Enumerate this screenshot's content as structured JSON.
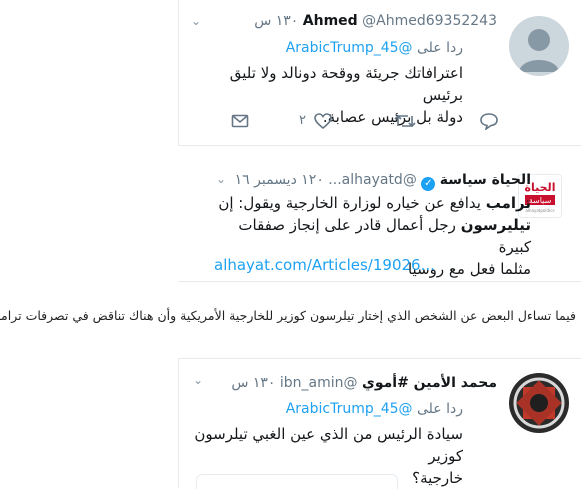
{
  "tweet1": {
    "name": "Ahmed",
    "handle": "@Ahmed69352243",
    "time": "١٣٠ س",
    "reply_prefix": "ردا على",
    "reply_mention": "@ArabicTrump_45",
    "body_line1": "اعترافاتك جريئة ووقحة دونالد ولا تليق برئيس",
    "body_line2": "دولة بل برئيس عصابة.",
    "like_count": "٢",
    "icons": [
      "chevron-down-icon",
      "reply-icon",
      "retweet-icon",
      "like-icon",
      "message-icon"
    ]
  },
  "tweet2": {
    "name": "الحياة سياسة",
    "verified": true,
    "handle": "@alhayatd...",
    "time": "١٢٠ ديسمبر ١٦",
    "logo_title": "الحياة",
    "logo_sub": "سياسة",
    "logo_tag": "alhayatpolitics",
    "body_bold1": "ترامب",
    "body_line1_rest": " يدافع عن خياره لوزارة الخارجية ويقول: إن",
    "body_bold2": "تيليرسون",
    "body_line2_rest": " رجل أعمال قادر على إنجاز صفقات كبيرة",
    "body_line3": "مثلما فعل مع روسيا",
    "link": "alhayat.com/Articles/19026..."
  },
  "paragraph": "فيما تساءل البعض عن الشخص الذي إختار تيلرسون كوزير للخارجية الأمريكية وأن هناك تناقض في تصرفات ترامب.",
  "tweet3": {
    "name": "محمد الأمين #أموي",
    "handle": "@ibn_amin",
    "time": "١٣٠ س",
    "reply_prefix": "ردا على",
    "reply_mention": "@ArabicTrump_45",
    "body_line1": "سيادة الرئيس من الذي عين الغبي تيلرسون كوزير",
    "body_line2": "خارجية؟"
  },
  "colors": {
    "link": "#1da1f2",
    "muted": "#657786",
    "border": "#e6ecf0",
    "verified": "#1da1f2",
    "logo_red": "#c8102e"
  }
}
